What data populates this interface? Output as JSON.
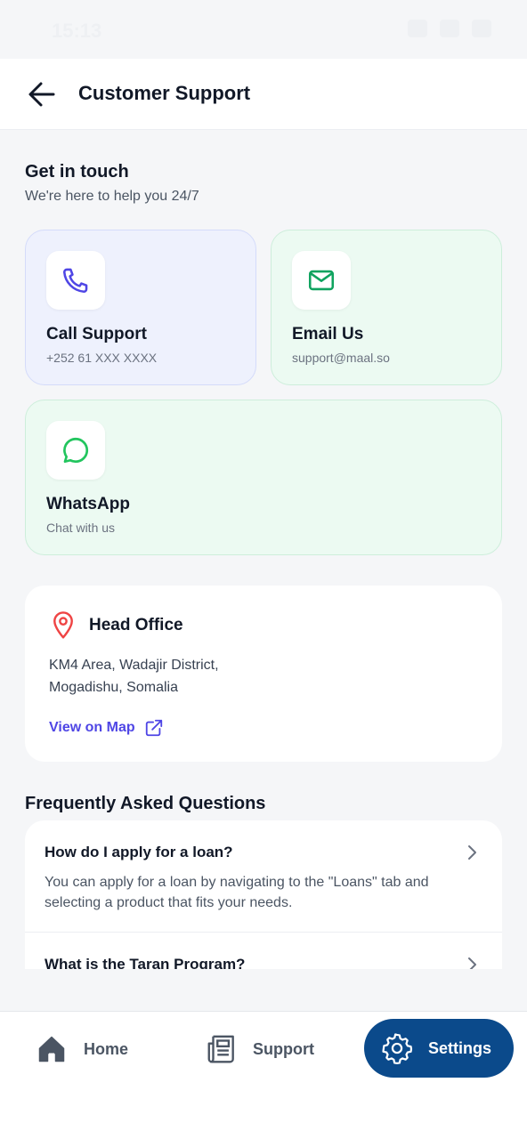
{
  "status_bar": {
    "time": "15:13"
  },
  "header": {
    "title": "Customer Support"
  },
  "get_in_touch": {
    "title": "Get in touch",
    "subtitle": "We're here to help you 24/7"
  },
  "contacts": {
    "call": {
      "label": "Call Support",
      "detail": "+252 61 XXX XXXX",
      "icon": "phone-icon",
      "color": "#4f46e5"
    },
    "email": {
      "label": "Email Us",
      "detail": "support@maal.so",
      "icon": "mail-icon",
      "color": "#10a35f"
    },
    "whatsapp": {
      "label": "WhatsApp",
      "detail": "Chat with us",
      "icon": "chat-bubble-icon",
      "color": "#22c55e"
    }
  },
  "office": {
    "title": "Head Office",
    "address_line1": "KM4 Area, Wadajir District,",
    "address_line2": "Mogadishu, Somalia",
    "map_link": "View on Map",
    "pin_color": "#ef4444"
  },
  "faq": {
    "title": "Frequently Asked Questions",
    "items": [
      {
        "question": "How do I apply for a loan?",
        "answer": "You can apply for a loan by navigating to the \"Loans\" tab and selecting a product that fits your needs."
      },
      {
        "question": "What is the Taran Program?"
      }
    ]
  },
  "bottom_nav": {
    "home": "Home",
    "support": "Support",
    "settings": "Settings",
    "active": "settings",
    "active_color": "#0b4a8b"
  }
}
